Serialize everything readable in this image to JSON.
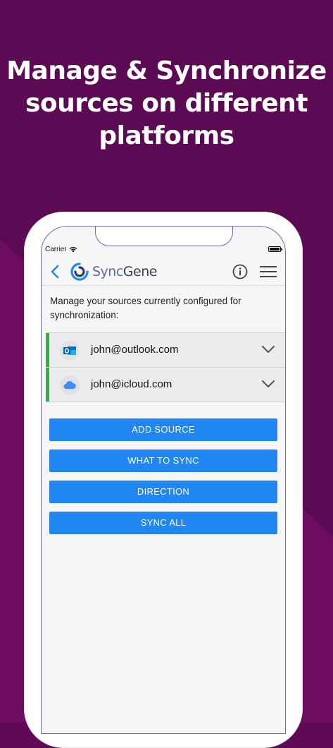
{
  "headline": {
    "line1": "Manage & Synchronize",
    "line2": "sources on different",
    "line3": "platforms"
  },
  "status_bar": {
    "carrier": "Carrier"
  },
  "app": {
    "logo_sync": "Sync",
    "logo_gene": "Gene"
  },
  "intro_text": "Manage your sources currently configured for synchronization:",
  "sources": [
    {
      "email": "john@outlook.com",
      "service_icon": "outlook-icon"
    },
    {
      "email": "john@icloud.com",
      "service_icon": "icloud-icon"
    }
  ],
  "actions": {
    "add_source": "ADD SOURCE",
    "what_to_sync": "WHAT TO SYNC",
    "direction": "DIRECTION",
    "sync_all": "SYNC ALL"
  },
  "colors": {
    "background": "#5e0a55",
    "accent_green": "#2fb33a",
    "button_blue": "#1f86f2"
  }
}
